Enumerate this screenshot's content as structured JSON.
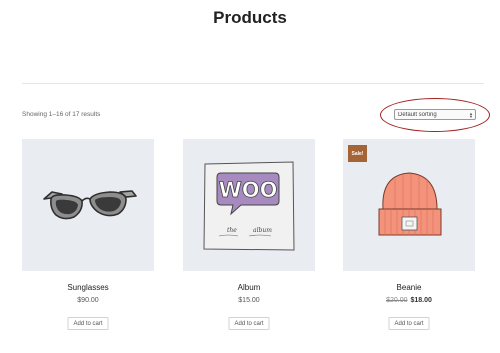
{
  "page": {
    "title": "Products"
  },
  "toolbar": {
    "result_count": "Showing 1–16 of 17 results",
    "sort": {
      "selected": "Default sorting"
    }
  },
  "products": [
    {
      "name": "Sunglasses",
      "price": "$90.00",
      "button": "Add to cart",
      "image_icon": "sunglasses-icon"
    },
    {
      "name": "Album",
      "price": "$15.00",
      "button": "Add to cart",
      "image_icon": "album-icon",
      "album_art": {
        "logo": "WOO",
        "caption_left": "the",
        "caption_right": "album"
      }
    },
    {
      "name": "Beanie",
      "old_price": "$20.00",
      "price": "$18.00",
      "button": "Add to cart",
      "image_icon": "beanie-icon",
      "badge": "Sale!"
    }
  ],
  "colors": {
    "image_bg": "#e9edf1",
    "annotation_circle": "#a1221f",
    "sale_badge": "#a46435",
    "album_purple": "#a78bc0",
    "beanie": "#f4937b"
  }
}
